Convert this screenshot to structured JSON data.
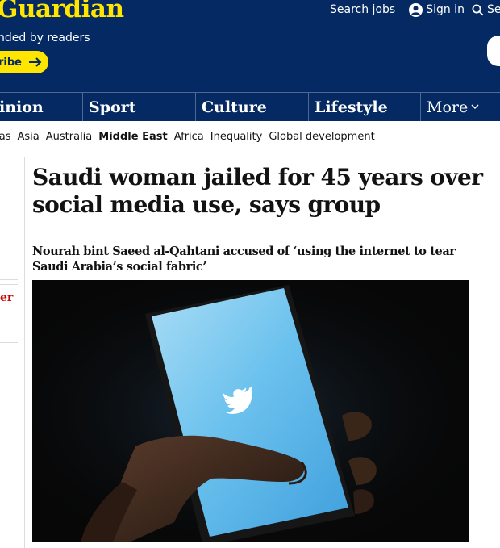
{
  "header": {
    "logo_text": "Guardian",
    "tagline": "nded by readers",
    "subscribe_label": "ribe",
    "links": [
      {
        "label": "Search jobs",
        "icon": "none"
      },
      {
        "label": "Sign in",
        "icon": "user-icon"
      },
      {
        "label": "Sea",
        "icon": "search-icon"
      }
    ],
    "colors": {
      "brand_blue": "#052962",
      "brand_yellow": "#ffe500"
    }
  },
  "nav": {
    "items": [
      "inion",
      "Sport",
      "Culture",
      "Lifestyle",
      "More"
    ]
  },
  "subnav": {
    "items": [
      "icas",
      "Asia",
      "Australia",
      "Middle East",
      "Africa",
      "Inequality",
      "Global development"
    ],
    "active": "Middle East"
  },
  "rail": {
    "kicker": "er"
  },
  "article": {
    "headline": "Saudi woman jailed for 45 years over social media use, says group",
    "standfirst": "Nourah bint Saeed al-Qahtani accused of ‘using the internet to tear Saudi Arabia’s social fabric’",
    "image_subject": "twitter-bird-logo on phone screen"
  }
}
